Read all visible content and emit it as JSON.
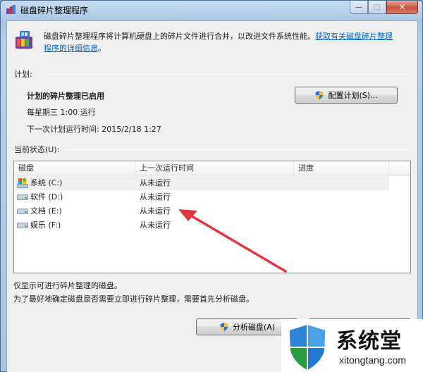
{
  "window": {
    "title": "磁盘碎片整理程序"
  },
  "caption": {
    "min": "—",
    "max": "□",
    "close": "✕"
  },
  "description": {
    "text": "磁盘碎片整理程序将计算机硬盘上的碎片文件进行合并，以改进文件系统性能。",
    "link_line1": "获取有关磁盘碎片整理",
    "link_line2": "程序的详细信息",
    "suffix": "。"
  },
  "schedule": {
    "group_label": "计划:",
    "title": "计划的碎片整理已启用",
    "when": "每星期三  1:00 运行",
    "next_run": "下一次计划运行时间: 2015/2/18 1:27",
    "configure_button": "配置计划(S)..."
  },
  "status": {
    "group_label": "当前状态(U):",
    "columns": [
      "磁盘",
      "上一次运行时间",
      "进度"
    ],
    "rows": [
      {
        "disk": "系统 (C:)",
        "last_run": "从未运行",
        "progress": "",
        "icon": "system-drive-icon"
      },
      {
        "disk": "软件 (D:)",
        "last_run": "从未运行",
        "progress": "",
        "icon": "drive-icon"
      },
      {
        "disk": "文档 (E:)",
        "last_run": "从未运行",
        "progress": "",
        "icon": "drive-icon"
      },
      {
        "disk": "娱乐 (F:)",
        "last_run": "从未运行",
        "progress": "",
        "icon": "drive-icon"
      }
    ]
  },
  "footer": {
    "note1": "仅显示可进行碎片整理的磁盘。",
    "note2": "为了最好地确定磁盘是否需要立即进行碎片整理，需要首先分析磁盘。",
    "analyze_button": "分析磁盘(A)"
  },
  "watermark": {
    "title": "系统堂",
    "url": "xitongtang.com"
  },
  "colors": {
    "link": "#0066cc",
    "arrow": "#e0373f"
  }
}
